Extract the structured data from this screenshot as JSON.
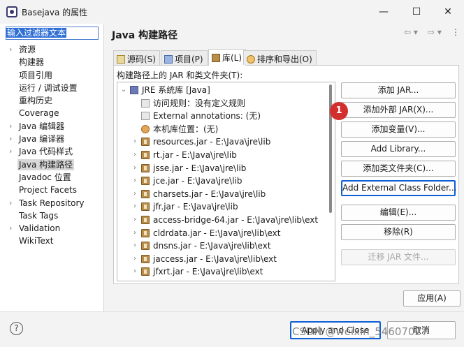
{
  "window": {
    "title": "Basejava 的属性"
  },
  "window_controls": {
    "minimize": "—",
    "maximize": "☐",
    "close": "✕"
  },
  "filter": {
    "value": "输入过滤器文本"
  },
  "nav": [
    {
      "label": "资源",
      "expandable": true
    },
    {
      "label": "构建器",
      "expandable": false
    },
    {
      "label": "项目引用",
      "expandable": false
    },
    {
      "label": "运行 / 调试设置",
      "expandable": false
    },
    {
      "label": "重构历史",
      "expandable": false
    },
    {
      "label": "Coverage",
      "expandable": false
    },
    {
      "label": "Java 编辑器",
      "expandable": true
    },
    {
      "label": "Java 编译器",
      "expandable": true
    },
    {
      "label": "Java 代码样式",
      "expandable": true
    },
    {
      "label": "Java 构建路径",
      "expandable": false,
      "selected": true
    },
    {
      "label": "Javadoc 位置",
      "expandable": false
    },
    {
      "label": "Project Facets",
      "expandable": false
    },
    {
      "label": "Task Repository",
      "expandable": true
    },
    {
      "label": "Task Tags",
      "expandable": false
    },
    {
      "label": "Validation",
      "expandable": true
    },
    {
      "label": "WikiText",
      "expandable": false
    }
  ],
  "page": {
    "title": "Java 构建路径",
    "history_back": "⇦ ▾",
    "history_forward": "⇨ ▾",
    "menu": "⋮"
  },
  "tabs": [
    {
      "label": "源码(S)",
      "active": false
    },
    {
      "label": "项目(P)",
      "active": false
    },
    {
      "label": "库(L)",
      "active": true
    },
    {
      "label": "排序和导出(O)",
      "active": false
    }
  ],
  "section_label": "构建路径上的 JAR 和类文件夹(T):",
  "tree": [
    {
      "label": "JRE 系统库 [Java]",
      "level": 0,
      "twisty": "⌄",
      "icon": "jre"
    },
    {
      "label": "访问规则：没有定义规则",
      "level": 1,
      "twisty": "",
      "icon": "small"
    },
    {
      "label": "External annotations:  (无)",
      "level": 1,
      "twisty": "",
      "icon": "small"
    },
    {
      "label": "本机库位置：(无)",
      "level": 1,
      "twisty": "",
      "icon": "native"
    },
    {
      "label": "resources.jar - E:\\Java\\jre\\lib",
      "level": 1,
      "twisty": "›",
      "icon": "jar"
    },
    {
      "label": "rt.jar - E:\\Java\\jre\\lib",
      "level": 1,
      "twisty": "›",
      "icon": "jar"
    },
    {
      "label": "jsse.jar - E:\\Java\\jre\\lib",
      "level": 1,
      "twisty": "›",
      "icon": "jar"
    },
    {
      "label": "jce.jar - E:\\Java\\jre\\lib",
      "level": 1,
      "twisty": "›",
      "icon": "jar"
    },
    {
      "label": "charsets.jar - E:\\Java\\jre\\lib",
      "level": 1,
      "twisty": "›",
      "icon": "jar"
    },
    {
      "label": "jfr.jar - E:\\Java\\jre\\lib",
      "level": 1,
      "twisty": "›",
      "icon": "jar"
    },
    {
      "label": "access-bridge-64.jar - E:\\Java\\jre\\lib\\ext",
      "level": 1,
      "twisty": "›",
      "icon": "jar"
    },
    {
      "label": "cldrdata.jar - E:\\Java\\jre\\lib\\ext",
      "level": 1,
      "twisty": "›",
      "icon": "jar"
    },
    {
      "label": "dnsns.jar - E:\\Java\\jre\\lib\\ext",
      "level": 1,
      "twisty": "›",
      "icon": "jar"
    },
    {
      "label": "jaccess.jar - E:\\Java\\jre\\lib\\ext",
      "level": 1,
      "twisty": "›",
      "icon": "jar"
    },
    {
      "label": "jfxrt.jar - E:\\Java\\jre\\lib\\ext",
      "level": 1,
      "twisty": "›",
      "icon": "jar"
    }
  ],
  "buttons": {
    "add_jar": "添加 JAR...",
    "add_external_jar": "添加外部 JAR(X)...",
    "add_variable": "添加变量(V)...",
    "add_library": "Add Library...",
    "add_class_folder": "添加类文件夹(C)...",
    "add_external_class_folder": "Add External Class Folder...",
    "edit": "编辑(E)...",
    "remove": "移除(R)",
    "migrate_jar": "迁移 JAR 文件..."
  },
  "badge": {
    "number": "1",
    "color": "#d32f2f"
  },
  "apply_button": "应用(A)",
  "footer": {
    "help": "?",
    "apply_close": "Apply and Close",
    "cancel": "取消"
  },
  "watermark": "CSDN @weixin_54607027",
  "colors": {
    "accent": "#0f5fd6",
    "selection": "#2f6fd6"
  }
}
